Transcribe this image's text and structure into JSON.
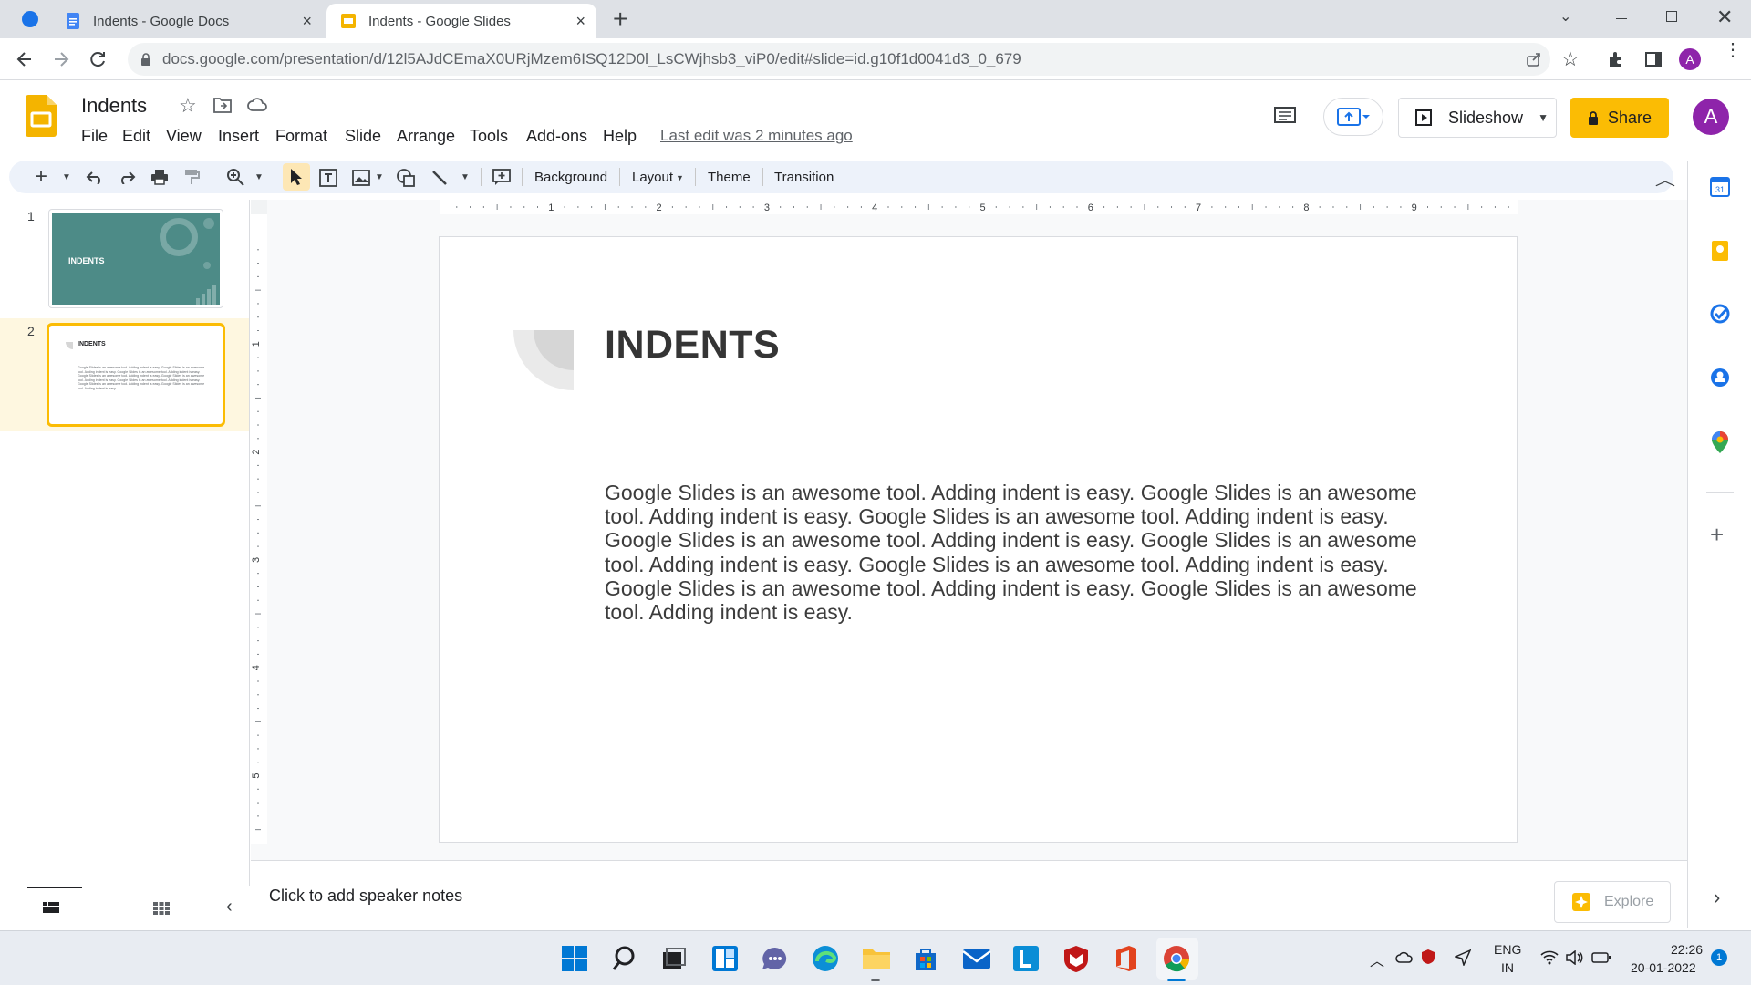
{
  "browser": {
    "tabs": [
      {
        "title": "Indents - Google Docs",
        "close": "×"
      },
      {
        "title": "Indents - Google Slides",
        "close": "×"
      }
    ],
    "new_tab": "+",
    "url": "docs.google.com/presentation/d/12l5AJdCEmaX0URjMzem6ISQ12D0l_LsCWjhsb3_viP0/edit#slide=id.g10f1d0041d3_0_679",
    "profile_initial": "A"
  },
  "docs": {
    "title": "Indents",
    "menu": [
      "File",
      "Edit",
      "View",
      "Insert",
      "Format",
      "Slide",
      "Arrange",
      "Tools",
      "Add-ons",
      "Help"
    ],
    "last_edit": "Last edit was 2 minutes ago",
    "slideshow_label": "Slideshow",
    "share_label": "Share",
    "avatar_initial": "A"
  },
  "toolbar": {
    "background": "Background",
    "layout": "Layout",
    "theme": "Theme",
    "transition": "Transition"
  },
  "ruler": {
    "horizontal": [
      "1",
      "2",
      "3",
      "4",
      "5",
      "6",
      "7",
      "8",
      "9"
    ],
    "vertical": [
      "1",
      "2",
      "3",
      "4",
      "5"
    ]
  },
  "filmstrip": {
    "slides": [
      {
        "number": "1",
        "title": "INDENTS"
      },
      {
        "number": "2",
        "title": "INDENTS"
      }
    ]
  },
  "slide": {
    "title": "INDENTS",
    "body": "Google Slides is an awesome tool. Adding indent is easy. Google Slides is an awesome tool. Adding indent is easy. Google Slides is an awesome tool. Adding indent is easy. Google Slides is an awesome tool. Adding indent is easy. Google Slides is an awesome tool. Adding indent is easy. Google Slides is an awesome tool. Adding indent is easy. Google Slides is an awesome tool. Adding indent is easy. Google Slides is an awesome tool. Adding indent is easy."
  },
  "notes": {
    "placeholder": "Click to add speaker notes"
  },
  "explore": {
    "label": "Explore"
  },
  "system": {
    "lang_line1": "ENG",
    "lang_line2": "IN",
    "time": "22:26",
    "date": "20-01-2022",
    "notification_count": "1"
  },
  "colors": {
    "slides_yellow": "#f4b400",
    "share_yellow": "#fbbc04",
    "teal": "#4d8b87",
    "avatar": "#8e24aa",
    "selection": "#fbbc04"
  }
}
